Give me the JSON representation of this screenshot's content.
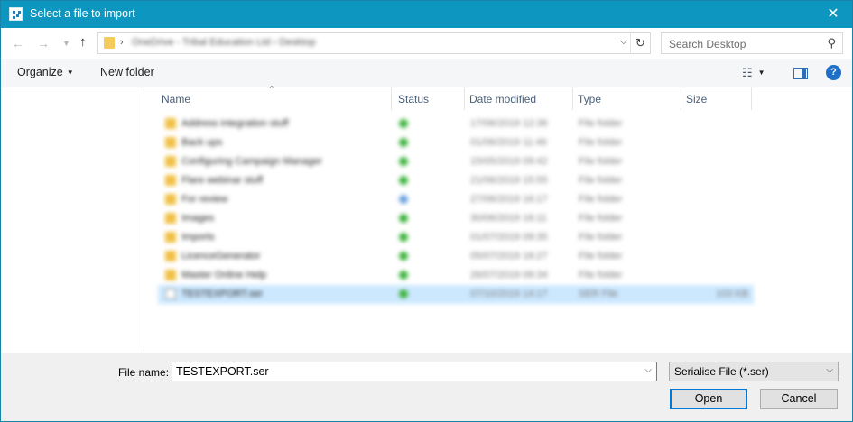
{
  "window": {
    "title": "Select a file to import"
  },
  "nav": {
    "address_path": "OneDrive - Tribal Education Ltd  ›  Desktop"
  },
  "search": {
    "placeholder": "Search Desktop"
  },
  "toolbar": {
    "organize_label": "Organize",
    "new_folder_label": "New folder"
  },
  "columns": [
    "Name",
    "Status",
    "Date modified",
    "Type",
    "Size"
  ],
  "files": [
    {
      "name": "Address integration stuff",
      "status": "synced",
      "date": "17/06/2019 12:36",
      "type": "File folder",
      "size": ""
    },
    {
      "name": "Back ups",
      "status": "synced",
      "date": "01/06/2019 11:46",
      "type": "File folder",
      "size": ""
    },
    {
      "name": "Configuring Campaign Manager",
      "status": "synced",
      "date": "15/05/2019 09:42",
      "type": "File folder",
      "size": ""
    },
    {
      "name": "Flare webinar stuff",
      "status": "synced",
      "date": "21/06/2019 15:55",
      "type": "File folder",
      "size": ""
    },
    {
      "name": "For review",
      "status": "cloud",
      "date": "27/06/2019 16:17",
      "type": "File folder",
      "size": ""
    },
    {
      "name": "Images",
      "status": "synced",
      "date": "30/06/2019 16:11",
      "type": "File folder",
      "size": ""
    },
    {
      "name": "Imports",
      "status": "synced",
      "date": "01/07/2019 09:35",
      "type": "File folder",
      "size": ""
    },
    {
      "name": "LicenceGenerator",
      "status": "synced",
      "date": "05/07/2019 16:27",
      "type": "File folder",
      "size": ""
    },
    {
      "name": "Master Online Help",
      "status": "synced",
      "date": "26/07/2019 09:34",
      "type": "File folder",
      "size": ""
    },
    {
      "name": "TESTEXPORT.ser",
      "status": "synced",
      "date": "07/10/2019 14:17",
      "type": "SER File",
      "size": "103 KB",
      "selected": true
    }
  ],
  "footer": {
    "file_name_label": "File name:",
    "file_name_value": "TESTEXPORT.ser",
    "filter_value": "Serialise File (*.ser)",
    "open_label": "Open",
    "cancel_label": "Cancel"
  }
}
